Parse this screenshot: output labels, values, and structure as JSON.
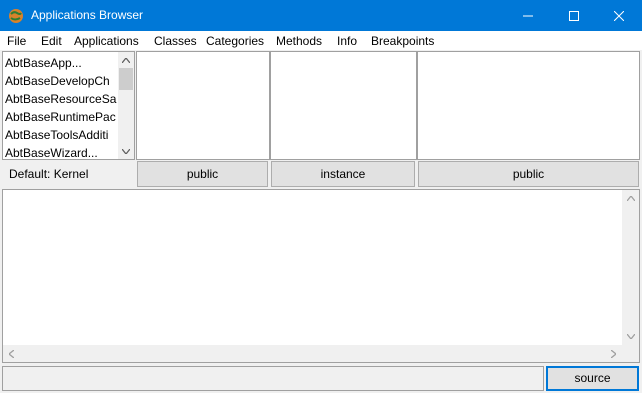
{
  "window": {
    "title": "Applications Browser",
    "icon": "app-globe-icon",
    "accent": "#0078d7"
  },
  "menu": [
    {
      "label": "File"
    },
    {
      "label": "Edit"
    },
    {
      "label": "Applications"
    },
    {
      "label": "Classes"
    },
    {
      "label": "Categories"
    },
    {
      "label": "Methods"
    },
    {
      "label": "Info"
    },
    {
      "label": "Breakpoints"
    }
  ],
  "applications": {
    "items": [
      "AbtBaseApp...",
      "AbtBaseDevelopCh",
      "AbtBaseResourceSa",
      "AbtBaseRuntimePac",
      "AbtBaseToolsAdditi",
      "AbtBaseWizard..."
    ]
  },
  "status": {
    "default_label": "Default: Kernel",
    "class_visibility": "public",
    "method_type": "instance",
    "method_visibility": "public"
  },
  "footer": {
    "source_label": "source"
  }
}
